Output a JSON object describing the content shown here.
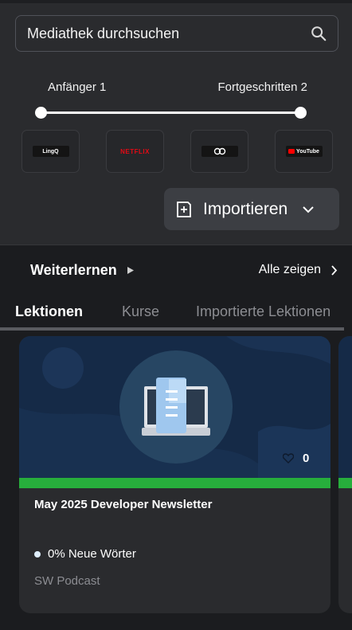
{
  "search": {
    "placeholder": "Mediathek durchsuchen"
  },
  "level": {
    "left": "Anfänger 1",
    "right": "Fortgeschritten 2"
  },
  "sources": [
    {
      "name": "LingQ",
      "icon": "lingq-logo"
    },
    {
      "name": "NETFLIX",
      "icon": "netflix-logo"
    },
    {
      "name": "",
      "icon": "podcast-logo"
    },
    {
      "name": "YouTube",
      "icon": "youtube-logo"
    }
  ],
  "import": {
    "label": "Importieren"
  },
  "continue": {
    "label": "Weiterlernen",
    "show_all": "Alle zeigen"
  },
  "tabs": [
    "Lektionen",
    "Kurse",
    "Importierte Lektionen"
  ],
  "card": {
    "likes": "0",
    "title": "May 2025 Developer Newsletter",
    "new_words": "0% Neue Wörter",
    "source": "SW Podcast",
    "progress_color": "#27ae3c"
  }
}
